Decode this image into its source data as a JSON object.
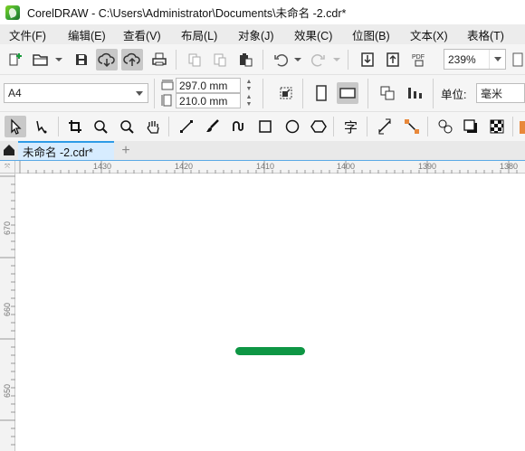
{
  "window": {
    "title": "CorelDRAW - C:\\Users\\Administrator\\Documents\\未命名 -2.cdr*"
  },
  "menu": [
    "文件(F)",
    "编辑(E)",
    "查看(V)",
    "布局(L)",
    "对象(J)",
    "效果(C)",
    "位图(B)",
    "文本(X)",
    "表格(T)"
  ],
  "toolbar": {
    "zoom": "239%"
  },
  "property_bar": {
    "page_size": "A4",
    "width": "297.0 mm",
    "height": "210.0 mm",
    "units_label": "单位:",
    "units_value": "毫米"
  },
  "tabs": [
    {
      "label": "未命名 -2.cdr*",
      "active": true
    }
  ],
  "ruler": {
    "horizontal_ticks": [
      "1430",
      "1420",
      "1410",
      "1400",
      "1390",
      "1380"
    ],
    "vertical_ticks": [
      "670",
      "660",
      "650"
    ]
  },
  "colors": {
    "accent": "#2e9be6",
    "shape_fill": "#0e9644",
    "menubar": "#ececec",
    "toolbar": "#f5f5f5"
  },
  "icons": {
    "toolbar_row1": [
      "new-document-icon",
      "open-folder-icon",
      "save-icon",
      "cloud-download-icon",
      "cloud-upload-icon",
      "print-icon",
      "copy-icon",
      "paste-icon",
      "paste-special-icon",
      "undo-icon",
      "redo-icon",
      "import-icon",
      "export-icon",
      "pdf-icon"
    ],
    "toolbox": [
      "pick-tool-icon",
      "shape-tool-icon",
      "crop-tool-icon",
      "zoom-tool-icon",
      "zoom-out-icon",
      "pan-tool-icon",
      "line-tool-icon",
      "brush-tool-icon",
      "artistic-media-icon",
      "rectangle-tool-icon",
      "ellipse-tool-icon",
      "polygon-tool-icon",
      "text-tool-icon",
      "connector-tool-icon",
      "dimension-tool-icon",
      "blend-tool-icon",
      "drop-shadow-icon",
      "transparency-icon"
    ]
  }
}
